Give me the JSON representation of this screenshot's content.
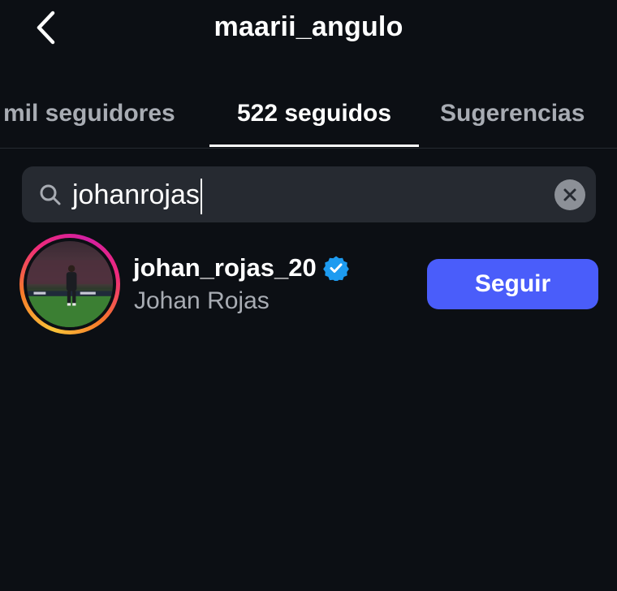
{
  "header": {
    "title": "maarii_angulo"
  },
  "tabs": [
    {
      "label": "mil seguidores",
      "active": false
    },
    {
      "label": "522 seguidos",
      "active": true
    },
    {
      "label": "Sugerencias",
      "active": false
    }
  ],
  "search": {
    "value": "johanrojas"
  },
  "results": [
    {
      "username": "johan_rojas_20",
      "full_name": "Johan Rojas",
      "verified": true,
      "follow_label": "Seguir"
    }
  ],
  "colors": {
    "background": "#0c0f14",
    "follow_button": "#4a5dfa",
    "verified_badge": "#1d9bf0",
    "inactive_text": "#a8acb3"
  }
}
